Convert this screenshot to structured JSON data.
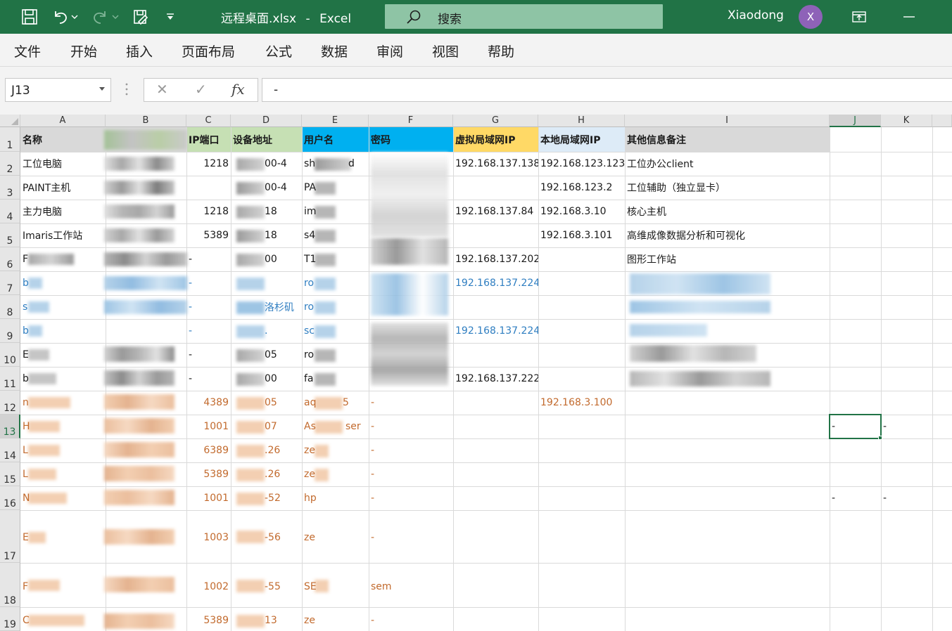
{
  "titlebar": {
    "filename": "远程桌面.xlsx",
    "separator": "-",
    "app": "Excel",
    "search_placeholder": "搜索",
    "user_name": "Xiaodong",
    "avatar_initial": "X",
    "accent_color": "#217346"
  },
  "menu": {
    "items": [
      "文件",
      "开始",
      "插入",
      "页面布局",
      "公式",
      "数据",
      "审阅",
      "视图",
      "帮助"
    ]
  },
  "formula_bar": {
    "name_box": "J13",
    "cancel_glyph": "✕",
    "enter_glyph": "✓",
    "fx_label": "fx",
    "content": "-"
  },
  "sheet": {
    "columns": [
      "A",
      "B",
      "C",
      "D",
      "E",
      "F",
      "G",
      "H",
      "I",
      "J",
      "K"
    ],
    "rows": [
      "1",
      "2",
      "3",
      "4",
      "5",
      "6",
      "7",
      "8",
      "9",
      "10",
      "11",
      "12",
      "13",
      "14",
      "15",
      "16",
      "17",
      "18",
      "19"
    ],
    "selected_cell": "J13",
    "headers": {
      "name": "名称",
      "port": "IP端口",
      "address": "设备地址",
      "username": "用户名",
      "password": "密码",
      "vlan_ip": "虚拟局域网IP",
      "lan_ip": "本地局域网IP",
      "notes": "其他信息备注"
    },
    "header_colors": {
      "gray": "#d9d9d9",
      "green": "#c6e0b4",
      "cyan": "#00b0f0",
      "yellow": "#ffd966",
      "lightblue": "#ddebf7"
    },
    "cells": {
      "a2": "工位电脑",
      "a3": "PAINT主机",
      "a4": "主力电脑",
      "a5": "Imaris工作站",
      "a6": "F",
      "a7": "b",
      "a8": "s",
      "a9": "b",
      "a10": "E",
      "a11": "b",
      "a12": "n",
      "a13": "H",
      "a14": "L",
      "a15": "L",
      "a16": "N",
      "a17": "E",
      "a18": "F",
      "a19": "C",
      "c2": "1218",
      "c4": "1218",
      "c5": "5389",
      "c6": "-",
      "c7": "-",
      "c8": "-",
      "c9": "-",
      "c10": "-",
      "c11": "-",
      "c12": "4389",
      "c13": "1001",
      "c14": "6389",
      "c15": "5389",
      "c16": "1001",
      "c17": "1003",
      "c18": "1002",
      "c19": "5389",
      "d2": "00-4",
      "d3": "00-4",
      "d4": "18",
      "d5": "18",
      "d6": "00",
      "d8": "洛杉矶",
      "d9": ".",
      "d10": "05",
      "d11": "00",
      "d12": "05",
      "d13": "07",
      "d14": ".26",
      "d15": ".26",
      "d16": "-52",
      "d17": "-56",
      "d18": "-55",
      "d19": "13",
      "e2": "sh",
      "e2b": "d",
      "e3": "PA",
      "e4": "im",
      "e5": "s4",
      "e6": "T1",
      "e7": "ro",
      "e8": "ro",
      "e9": "sc",
      "e10": "ro",
      "e11": "fa",
      "e12": "aq",
      "e12b": "5",
      "e13": "As",
      "e13b": "ser",
      "e14": "ze",
      "e15": "ze",
      "e16": "hp",
      "e17": "ze",
      "e18": "SE",
      "e19": "ze",
      "f12": "-",
      "f13": "-",
      "f14": "-",
      "f15": "-",
      "f16": "-",
      "f17": "-",
      "f18": "sem",
      "f19": "-",
      "g2": "192.168.137.138",
      "g4": "192.168.137.84",
      "g6": "192.168.137.202",
      "g7": "192.168.137.224",
      "g9": "192.168.137.224",
      "g11": "192.168.137.222",
      "h2": "192.168.123.123",
      "h3": "192.168.123.2",
      "h4": "192.168.3.10",
      "h5": "192.168.3.101",
      "h12": "192.168.3.100",
      "i2": "工位办公client",
      "i3": "工位辅助（独立显卡）",
      "i4": "核心主机",
      "i5": "高维成像数据分析和可视化",
      "i6": "图形工作站",
      "j13": "-",
      "k13": "-",
      "j16": "-",
      "k16": "-"
    }
  }
}
